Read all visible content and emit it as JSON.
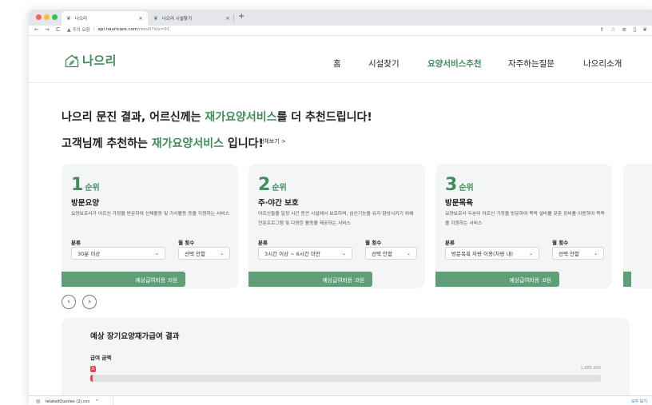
{
  "browser": {
    "traffic_lights": [
      "#ff5f57",
      "#febc2e",
      "#28c840"
    ],
    "tabs": [
      {
        "title": "나으리",
        "active": true
      },
      {
        "title": "나으리 시설찾기",
        "active": false
      }
    ],
    "tab_close": "×",
    "new_tab": "+",
    "nav": {
      "back": "←",
      "forward": "→",
      "reload": "C"
    },
    "address": {
      "security_label": "주의 요함",
      "domain": "api.nauricare.com",
      "path": "/result?idx=91"
    },
    "toolbar_icons": [
      "share-icon",
      "star-icon",
      "extensions-icon",
      "sidebar-icon",
      "profile-icon"
    ]
  },
  "site": {
    "brand": "나으리",
    "accent": "#3f8d5b",
    "menu": [
      {
        "label": "홈",
        "active": false
      },
      {
        "label": "시설찾기",
        "active": false
      },
      {
        "label": "요양서비스추천",
        "active": true
      },
      {
        "label": "자주하는질문",
        "active": false
      },
      {
        "label": "나으리소개",
        "active": false
      }
    ]
  },
  "main": {
    "headline1": {
      "pre": "나으리 문진 결과, 어르신께는 ",
      "highlight": "재가요양서비스",
      "post": "를 더 추천드립니다!"
    },
    "headline2": {
      "pre": "고객님께 추천하는 ",
      "highlight": "재가요양서비스",
      "post": " 입니다!"
    },
    "see_all": "전체보기 >",
    "cards": [
      {
        "rank": "1",
        "rank_unit": "순위",
        "title": "방문요양",
        "desc": "요양보호사가 어르신 가정을 방문하여 신체활동 및 가사활동 등을 지원하는 서비스",
        "category_label": "분류",
        "category_value": "30분 이상",
        "freq_label": "월 횟수",
        "freq_value": "선택 안함",
        "cost": "예상급여비용 :0원"
      },
      {
        "rank": "2",
        "rank_unit": "순위",
        "title": "주·야간 보호",
        "desc": "어르신들을 일정 시간 동안 시설에서 보호하며, 심신기능을 유지·향상시키기 위해 전문프로그램 및 다양한 활동을 제공하는 서비스",
        "category_label": "분류",
        "category_value": "3시간 이상 ~ 6시간 미만",
        "freq_label": "월 횟수",
        "freq_value": "선택 안함",
        "cost": "예상급여비용 :0원"
      },
      {
        "rank": "3",
        "rank_unit": "순위",
        "title": "방문목욕",
        "desc": "요양보호사 두분이 어르신 가정을 방문하여 목욕 설비를 갖춘 장비를 이용하여 목욕을 지원하는 서비스",
        "category_label": "분류",
        "category_value": "방문목욕 차량 이용(차량 내)",
        "freq_label": "월 횟수",
        "freq_value": "선택 안함",
        "cost": "예상급여비용 :0원"
      }
    ],
    "prev_arrow": "‹",
    "next_arrow": "›",
    "result": {
      "title": "예상 장기요양재가급여 결과",
      "subtitle": "급여 금액",
      "current_badge": "0",
      "max_value": "1,885,000",
      "progress": 0.004
    }
  },
  "downloads": {
    "file": "relatedQueries (2).csv",
    "chevron": "^",
    "show_all": "모두 보기"
  }
}
